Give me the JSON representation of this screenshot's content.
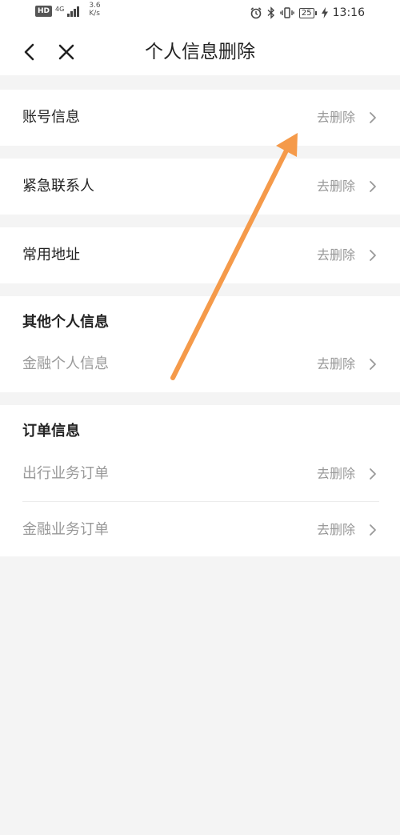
{
  "status_bar": {
    "hd_badge": "HD",
    "network": "4G",
    "speed_value": "3.6",
    "speed_unit": "K/s",
    "battery": "25",
    "time": "13:16"
  },
  "nav": {
    "title": "个人信息删除",
    "back_icon": "chevron-left-icon",
    "close_icon": "close-icon"
  },
  "sections": {
    "account": {
      "label": "账号信息",
      "action": "去删除"
    },
    "emergency": {
      "label": "紧急联系人",
      "action": "去删除"
    },
    "address": {
      "label": "常用地址",
      "action": "去删除"
    },
    "other": {
      "title": "其他个人信息",
      "items": [
        {
          "label": "金融个人信息",
          "action": "去删除"
        }
      ]
    },
    "orders": {
      "title": "订单信息",
      "items": [
        {
          "label": "出行业务订单",
          "action": "去删除"
        },
        {
          "label": "金融业务订单",
          "action": "去删除"
        }
      ]
    }
  },
  "colors": {
    "background": "#f4f4f4",
    "card": "#ffffff",
    "text_primary": "#222222",
    "text_secondary": "#999999",
    "annotation_arrow": "#f59a4a"
  }
}
